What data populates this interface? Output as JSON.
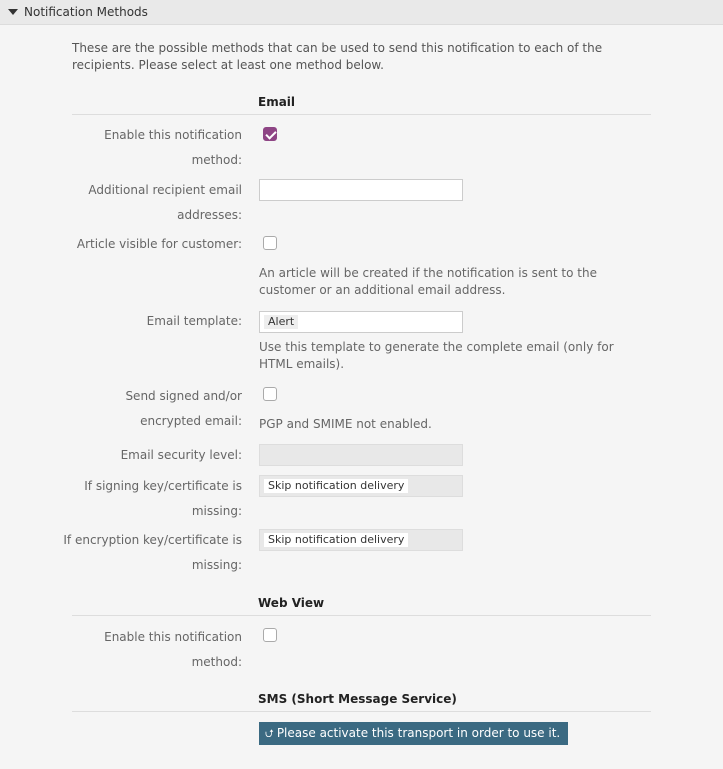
{
  "header": {
    "title": "Notification Methods",
    "toggle_icon": "triangle-down-icon"
  },
  "intro": "These are the possible methods that can be used to send this notification to each of the recipients. Please select at least one method below.",
  "email": {
    "title": "Email",
    "enable_label": "Enable this notification method:",
    "enable_checked": true,
    "recipients_label": "Additional recipient email addresses:",
    "recipients_value": "",
    "article_visible_label": "Article visible for customer:",
    "article_visible_checked": false,
    "article_help": "An article will be created if the notification is sent to the customer or an additional email address.",
    "template_label": "Email template:",
    "template_value": "Alert",
    "template_help": "Use this template to generate the complete email (only for HTML emails).",
    "signed_label": "Send signed and/or encrypted email:",
    "signed_checked": false,
    "signed_help": "PGP and SMIME not enabled.",
    "security_level_label": "Email security level:",
    "security_level_value": "",
    "signing_missing_label": "If signing key/certificate is missing:",
    "signing_missing_value": "Skip notification delivery",
    "encryption_missing_label": "If encryption key/certificate is missing:",
    "encryption_missing_value": "Skip notification delivery"
  },
  "webview": {
    "title": "Web View",
    "enable_label": "Enable this notification method:",
    "enable_checked": false
  },
  "sms": {
    "title": "SMS (Short Message Service)",
    "activate_label": "Please activate this transport in order to use it.",
    "activate_icon": "double-chevron-up-icon"
  },
  "colors": {
    "checkbox_accent": "#8e4585",
    "activate_button": "#3b6a82"
  }
}
